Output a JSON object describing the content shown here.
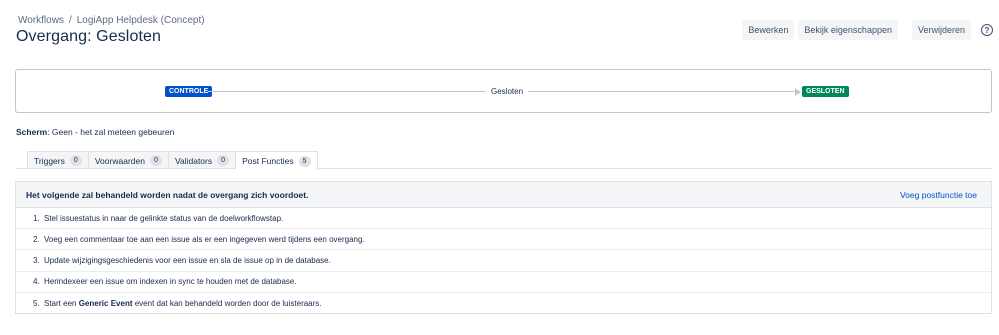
{
  "breadcrumb": {
    "workflows": "Workflows",
    "separator": "/",
    "project": "LogiApp Helpdesk (Concept)"
  },
  "title": "Overgang: Gesloten",
  "actions": {
    "edit": "Bewerken",
    "properties": "Bekijk eigenschappen",
    "delete": "Verwijderen",
    "help_glyph": "?"
  },
  "diagram": {
    "from_status": "CONTROLE",
    "transition": "Gesloten",
    "to_status": "GESLOTEN",
    "from_color": "#0052cc",
    "to_color": "#00875a"
  },
  "screen": {
    "label": "Scherm",
    "value": ": Geen - het zal meteen gebeuren"
  },
  "tabs": [
    {
      "label": "Triggers",
      "count": "0"
    },
    {
      "label": "Voorwaarden",
      "count": "0"
    },
    {
      "label": "Validators",
      "count": "0"
    },
    {
      "label": "Post Functies",
      "count": "5"
    }
  ],
  "post_functions": {
    "header": "Het volgende zal behandeld worden nadat de overgang zich voordoet.",
    "add_link": "Voeg postfunctie toe",
    "items": [
      {
        "num": "1.",
        "text": "Stel issuestatus in naar de gelinkte status van de doelworkflowstap."
      },
      {
        "num": "2.",
        "text": "Voeg een commentaar toe aan een issue als er een ingegeven werd tijdens een overgang."
      },
      {
        "num": "3.",
        "text": "Update wijzigingsgeschiedenis voor een issue en sla de issue op in de database."
      },
      {
        "num": "4.",
        "text": "Herindexeer een issue om indexen in sync te houden met de database."
      },
      {
        "num": "5.",
        "pre": "Start een ",
        "bold": "Generic Event",
        "post": " event dat kan behandeld worden door de luisteraars."
      }
    ]
  }
}
